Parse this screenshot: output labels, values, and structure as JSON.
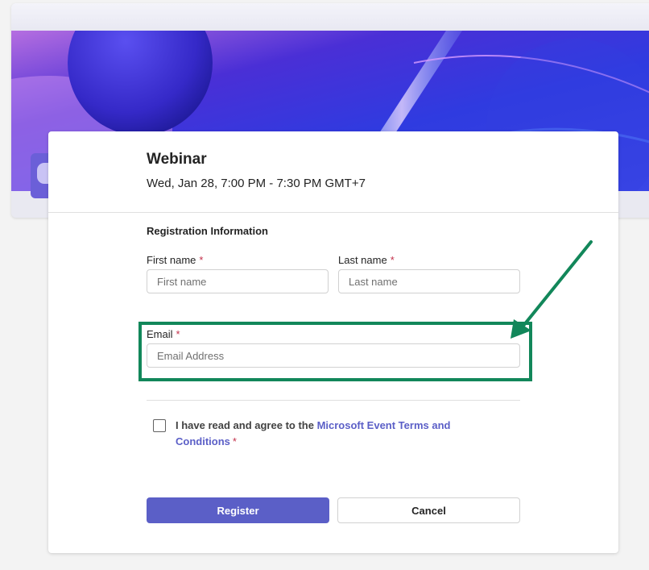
{
  "event": {
    "title": "Webinar",
    "datetime": "Wed, Jan 28, 7:00 PM - 7:30 PM GMT+7"
  },
  "form": {
    "section_title": "Registration Information",
    "first_name": {
      "label": "First name",
      "placeholder": "First name",
      "value": ""
    },
    "last_name": {
      "label": "Last name",
      "placeholder": "Last name",
      "value": ""
    },
    "email": {
      "label": "Email",
      "placeholder": "Email Address",
      "value": ""
    },
    "required_marker": "*",
    "consent": {
      "text": "I have read and agree to the ",
      "link": "Microsoft Event Terms and Conditions",
      "checked": false
    },
    "register_label": "Register",
    "cancel_label": "Cancel"
  },
  "annotation": {
    "color": "#12875a",
    "target": "email-field"
  },
  "colors": {
    "accent": "#5b5fc7",
    "required": "#c4314b"
  }
}
